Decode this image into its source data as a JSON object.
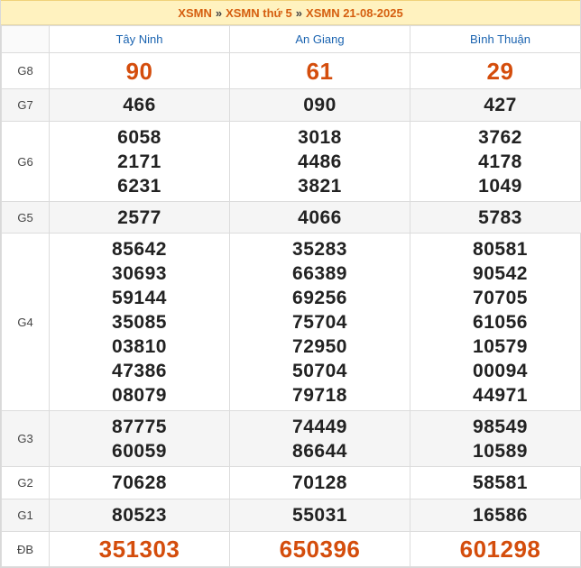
{
  "breadcrumb": {
    "items": [
      "XSMN",
      "XSMN thứ 5",
      "XSMN 21-08-2025"
    ],
    "separator": "»"
  },
  "provinces": [
    "Tây Ninh",
    "An Giang",
    "Bình Thuận"
  ],
  "colors": {
    "accent": "#d55e0f",
    "header_text": "#1a63b0",
    "highlight_bg": "#fff2bf"
  },
  "prizes": [
    {
      "label": "G8",
      "results": [
        [
          "90"
        ],
        [
          "61"
        ],
        [
          "29"
        ]
      ]
    },
    {
      "label": "G7",
      "results": [
        [
          "466"
        ],
        [
          "090"
        ],
        [
          "427"
        ]
      ]
    },
    {
      "label": "G6",
      "results": [
        [
          "6058",
          "2171",
          "6231"
        ],
        [
          "3018",
          "4486",
          "3821"
        ],
        [
          "3762",
          "4178",
          "1049"
        ]
      ]
    },
    {
      "label": "G5",
      "results": [
        [
          "2577"
        ],
        [
          "4066"
        ],
        [
          "5783"
        ]
      ]
    },
    {
      "label": "G4",
      "results": [
        [
          "85642",
          "30693",
          "59144",
          "35085",
          "03810",
          "47386",
          "08079"
        ],
        [
          "35283",
          "66389",
          "69256",
          "75704",
          "72950",
          "50704",
          "79718"
        ],
        [
          "80581",
          "90542",
          "70705",
          "61056",
          "10579",
          "00094",
          "44971"
        ]
      ]
    },
    {
      "label": "G3",
      "results": [
        [
          "87775",
          "60059"
        ],
        [
          "74449",
          "86644"
        ],
        [
          "98549",
          "10589"
        ]
      ]
    },
    {
      "label": "G2",
      "results": [
        [
          "70628"
        ],
        [
          "70128"
        ],
        [
          "58581"
        ]
      ]
    },
    {
      "label": "G1",
      "results": [
        [
          "80523"
        ],
        [
          "55031"
        ],
        [
          "16586"
        ]
      ]
    },
    {
      "label": "ĐB",
      "results": [
        [
          "351303"
        ],
        [
          "650396"
        ],
        [
          "601298"
        ]
      ]
    }
  ]
}
